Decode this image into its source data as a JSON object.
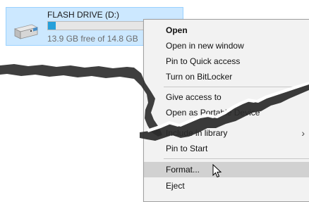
{
  "drive": {
    "name": "FLASH DRIVE (D:)",
    "free_text": "13.9 GB free of 14.8 GB",
    "used_fraction": 0.06,
    "icon": "usb-drive-icon"
  },
  "menu": {
    "open": "Open",
    "open_new_window": "Open in new window",
    "pin_quick_access": "Pin to Quick access",
    "turn_on_bitlocker": "Turn on BitLocker",
    "give_access": "Give access to",
    "open_portable": "Open as Portable Device",
    "include_library": "Include in library",
    "pin_start": "Pin to Start",
    "format": "Format...",
    "eject": "Eject"
  },
  "colors": {
    "drive_selected_bg": "#cce8ff",
    "bar_fill": "#26a0da",
    "menu_bg": "#f2f2f2",
    "highlight": "#d1d1d1"
  }
}
